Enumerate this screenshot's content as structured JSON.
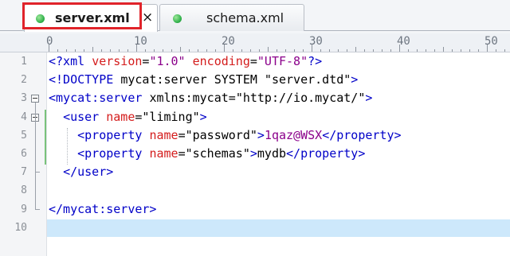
{
  "tabs": [
    {
      "label": "server.xml",
      "active": true,
      "close_icon": "×"
    },
    {
      "label": "schema.xml",
      "active": false
    }
  ],
  "ruler": {
    "labels": [
      "0",
      "10",
      "20",
      "30",
      "40",
      "50"
    ]
  },
  "code_lines": [
    {
      "number": "1",
      "segments": [
        {
          "cls": "t",
          "text": "<?xml "
        },
        {
          "cls": "a",
          "text": "version"
        },
        {
          "cls": "tx",
          "text": "="
        },
        {
          "cls": "v",
          "text": "\"1.0\""
        },
        {
          "cls": "tx",
          "text": " "
        },
        {
          "cls": "a",
          "text": "encoding"
        },
        {
          "cls": "tx",
          "text": "="
        },
        {
          "cls": "v",
          "text": "\"UTF-8\""
        },
        {
          "cls": "t",
          "text": "?>"
        }
      ]
    },
    {
      "number": "2",
      "segments": [
        {
          "cls": "t",
          "text": "<!DOCTYPE "
        },
        {
          "cls": "tx",
          "text": "mycat:server SYSTEM \"server.dtd\""
        },
        {
          "cls": "t",
          "text": ">"
        }
      ]
    },
    {
      "number": "3",
      "segments": [
        {
          "cls": "t",
          "text": "<mycat:server "
        },
        {
          "cls": "tx",
          "text": "xmlns:mycat"
        },
        {
          "cls": "tx",
          "text": "="
        },
        {
          "cls": "tx",
          "text": "\"http://io.mycat/\""
        },
        {
          "cls": "t",
          "text": ">"
        }
      ]
    },
    {
      "number": "4",
      "segments": [
        {
          "cls": "tx",
          "text": "  "
        },
        {
          "cls": "t",
          "text": "<user "
        },
        {
          "cls": "a",
          "text": "name"
        },
        {
          "cls": "tx",
          "text": "="
        },
        {
          "cls": "tx",
          "text": "\"liming\""
        },
        {
          "cls": "t",
          "text": ">"
        }
      ]
    },
    {
      "number": "5",
      "segments": [
        {
          "cls": "tx",
          "text": "    "
        },
        {
          "cls": "t",
          "text": "<property "
        },
        {
          "cls": "a",
          "text": "name"
        },
        {
          "cls": "tx",
          "text": "="
        },
        {
          "cls": "tx",
          "text": "\"password\""
        },
        {
          "cls": "t",
          "text": ">"
        },
        {
          "cls": "v",
          "text": "1qaz@WSX"
        },
        {
          "cls": "t",
          "text": "</property>"
        }
      ]
    },
    {
      "number": "6",
      "segments": [
        {
          "cls": "tx",
          "text": "    "
        },
        {
          "cls": "t",
          "text": "<property "
        },
        {
          "cls": "a",
          "text": "name"
        },
        {
          "cls": "tx",
          "text": "="
        },
        {
          "cls": "tx",
          "text": "\"schemas\""
        },
        {
          "cls": "t",
          "text": ">"
        },
        {
          "cls": "tx",
          "text": "mydb"
        },
        {
          "cls": "t",
          "text": "</property>"
        }
      ]
    },
    {
      "number": "7",
      "segments": [
        {
          "cls": "tx",
          "text": "  "
        },
        {
          "cls": "t",
          "text": "</user>"
        }
      ]
    },
    {
      "number": "8",
      "segments": []
    },
    {
      "number": "9",
      "segments": [
        {
          "cls": "t",
          "text": "</mycat:server>"
        }
      ]
    },
    {
      "number": "10",
      "segments": []
    }
  ],
  "colors": {
    "tag": "#0000c8",
    "attribute": "#d41c1c",
    "value": "#8b008b",
    "current_line": "#cde8fb",
    "highlight_box": "#e0232a"
  }
}
